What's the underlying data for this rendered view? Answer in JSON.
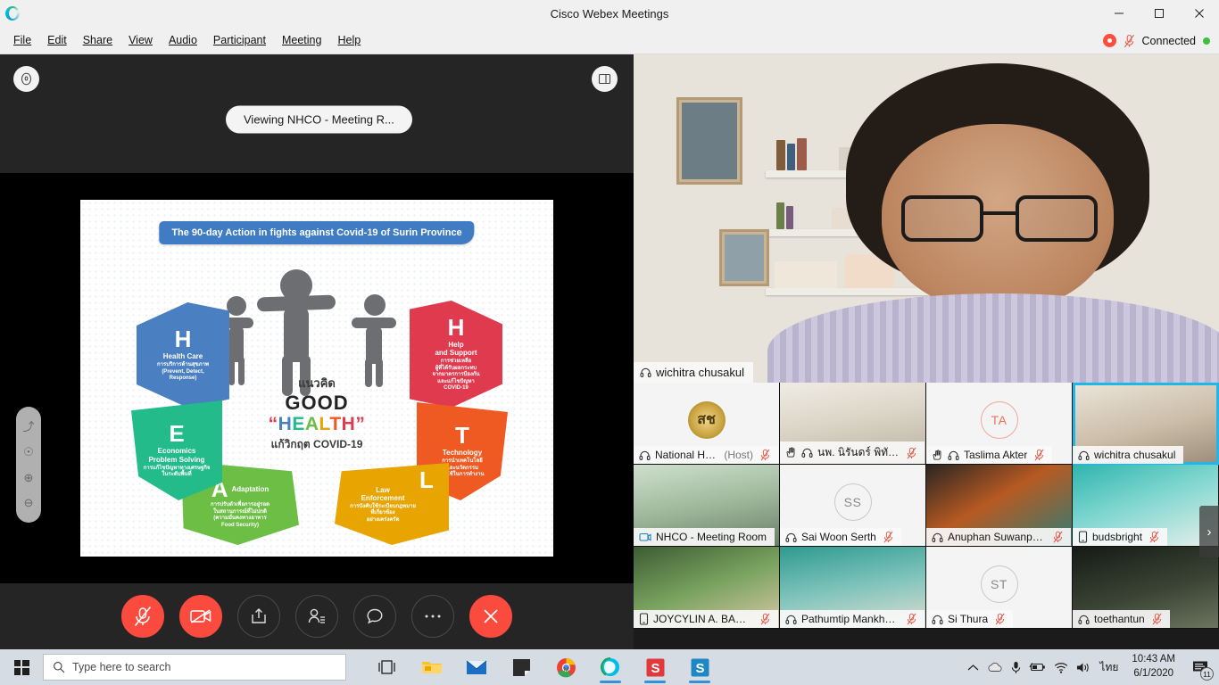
{
  "window": {
    "title": "Cisco Webex Meetings",
    "logo_icon": "webex-logo-icon",
    "minimize_label": "—",
    "maximize_label": "❐",
    "close_label": "✕"
  },
  "menu": {
    "items": [
      {
        "label": "File"
      },
      {
        "label": "Edit"
      },
      {
        "label": "Share"
      },
      {
        "label": "View"
      },
      {
        "label": "Audio"
      },
      {
        "label": "Participant"
      },
      {
        "label": "Meeting"
      },
      {
        "label": "Help"
      }
    ],
    "status": {
      "recording_icon": "recording-dot-icon",
      "mic_muted_icon": "microphone-muted-icon",
      "connection_label": "Connected",
      "connection_color": "#3fbf3f"
    }
  },
  "share": {
    "annotate_icon": "annotate-circle-icon",
    "layout_icon": "layout-panel-icon",
    "viewing_label": "Viewing NHCO - Meeting R...",
    "tools": [
      {
        "name": "pointer-tool",
        "glyph": "⤴"
      },
      {
        "name": "laser-pointer-tool",
        "glyph": "☉"
      },
      {
        "name": "zoom-in-tool",
        "glyph": "⊕"
      },
      {
        "name": "zoom-out-tool",
        "glyph": "⊖"
      }
    ]
  },
  "slide": {
    "banner": "The 90-day Action in fights against Covid-19 of Surin Province",
    "center": {
      "line1": "แนวคิด",
      "good": "GOOD",
      "health_letters": [
        {
          "ch": "“",
          "color": "#e03a4e"
        },
        {
          "ch": "H",
          "color": "#4a7fc1"
        },
        {
          "ch": "E",
          "color": "#23bb8a"
        },
        {
          "ch": "A",
          "color": "#6cbe45"
        },
        {
          "ch": "L",
          "color": "#e8a400"
        },
        {
          "ch": "T",
          "color": "#ef5a22"
        },
        {
          "ch": "H",
          "color": "#e03a4e"
        },
        {
          "ch": "”",
          "color": "#e03a4e"
        }
      ],
      "line4": "แก้วิกฤต COVID-19"
    },
    "petals": [
      {
        "key": "health-care",
        "letter": "H",
        "english": "Health Care",
        "thai": "การบริการด้านสุขภาพ\n(Prevent, Detect,\nResponse)",
        "color": "#4a7fc1"
      },
      {
        "key": "help-and-support",
        "letter": "H",
        "english": "Help\nand Support",
        "thai": "การช่วยเหลือ\nผู้ที่ได้รับผลกระทบ\nจากมาตรการป้องกัน\nและแก้ไขปัญหา\nCOVID-19",
        "color": "#e03a4e"
      },
      {
        "key": "technology",
        "letter": "T",
        "english": "Technology",
        "thai": "การนำเทคโนโลยี\nและนวัตกรรม\nมาใช้ในการทำงาน",
        "color": "#ef5a22"
      },
      {
        "key": "law-enforcement",
        "letter": "L",
        "english": "Law\nEnforcement",
        "thai": "การบังคับใช้ระเบียบกฎหมาย\nที่เกี่ยวข้อง\nอย่างเคร่งครัด",
        "color": "#e8a400"
      },
      {
        "key": "adaptation",
        "letter": "A",
        "english": "Adaptation",
        "thai": "การปรับตัวเพื่อการอยู่รอด\nในสถานการณ์ที่ไม่ปกติ\n(ความมั่นคงทางอาหาร\nFood Security)",
        "color": "#6cbe45"
      },
      {
        "key": "economics-problem-solving",
        "letter": "E",
        "english": "Economics\nProblem Solving",
        "thai": "การแก้ไขปัญหาทางเศรษฐกิจ\nในระดับพื้นที่",
        "color": "#23bb8a"
      }
    ]
  },
  "controls": [
    {
      "name": "mute-button",
      "icon": "microphone-muted-icon",
      "style": "red"
    },
    {
      "name": "stop-video-button",
      "icon": "camera-off-icon",
      "style": "red"
    },
    {
      "name": "share-screen-button",
      "icon": "share-upload-icon",
      "style": "plain"
    },
    {
      "name": "participants-button",
      "icon": "participants-icon",
      "style": "plain"
    },
    {
      "name": "chat-button",
      "icon": "chat-bubble-icon",
      "style": "plain"
    },
    {
      "name": "more-options-button",
      "icon": "ellipsis-icon",
      "style": "plain"
    },
    {
      "name": "leave-meeting-button",
      "icon": "close-x-icon",
      "style": "red"
    }
  ],
  "video": {
    "active_speaker": {
      "name": "wichitra chusakul",
      "audio_icon": "headset-icon"
    },
    "scroll_next_label": "›",
    "participants": [
      {
        "name": "National Heal...",
        "suffix": "(Host)",
        "icons": [
          "headset-icon"
        ],
        "muted": true,
        "tile": "logo",
        "logo_text": "สช",
        "active": false
      },
      {
        "name": "นพ. นิรันดร์ พิทักษ์วั...",
        "suffix": "",
        "icons": [
          "hand-raised-icon",
          "headset-icon"
        ],
        "muted": true,
        "tile": "video-office",
        "active": false
      },
      {
        "name": "Taslima Akter",
        "suffix": "",
        "icons": [
          "hand-raised-icon",
          "headset-icon"
        ],
        "muted": true,
        "tile": "initials",
        "initials": "TA",
        "active": false
      },
      {
        "name": "wichitra chusakul",
        "suffix": "",
        "icons": [
          "headset-icon"
        ],
        "muted": false,
        "tile": "video-speaker",
        "active": true
      },
      {
        "name": "NHCO - Meeting Room",
        "suffix": "",
        "icons": [
          "device-video-icon"
        ],
        "muted": false,
        "tile": "video-presenter",
        "active": false
      },
      {
        "name": "Sai Woon Serth",
        "suffix": "",
        "icons": [
          "headset-icon"
        ],
        "muted": true,
        "tile": "initials",
        "initials": "SS",
        "active": false
      },
      {
        "name": "Anuphan Suwanphan",
        "suffix": "",
        "icons": [
          "headset-icon"
        ],
        "muted": true,
        "tile": "video-desk",
        "active": false
      },
      {
        "name": "budsbright",
        "suffix": "",
        "icons": [
          "phone-icon"
        ],
        "muted": true,
        "tile": "video-stairs",
        "active": false
      },
      {
        "name": "JOYCYLIN A. BASTIAN",
        "suffix": "",
        "icons": [
          "phone-icon"
        ],
        "muted": true,
        "tile": "video-green",
        "active": false
      },
      {
        "name": "Pathumtip Mankho...",
        "suffix": "",
        "icons": [
          "headset-icon"
        ],
        "muted": true,
        "tile": "video-teal",
        "active": false
      },
      {
        "name": "Si Thura",
        "suffix": "",
        "icons": [
          "headset-icon"
        ],
        "muted": true,
        "tile": "initials",
        "initials": "ST",
        "active": false
      },
      {
        "name": "toethantun",
        "suffix": "",
        "icons": [
          "headset-icon"
        ],
        "muted": true,
        "tile": "video-dark",
        "active": false
      }
    ]
  },
  "taskbar": {
    "start_icon": "windows-start-icon",
    "search": {
      "placeholder": "Type here to search",
      "icon": "search-icon"
    },
    "apps": [
      {
        "name": "task-view-icon",
        "glyph": "⧉"
      },
      {
        "name": "file-explorer-icon"
      },
      {
        "name": "mail-icon"
      },
      {
        "name": "sticky-notes-icon"
      },
      {
        "name": "chrome-icon"
      },
      {
        "name": "webex-icon"
      },
      {
        "name": "snagit-editor-icon"
      },
      {
        "name": "snagit-capture-icon"
      }
    ],
    "tray": {
      "overflow_icon": "chevron-up-icon",
      "cloud_icon": "onedrive-icon",
      "mic_icon": "microphone-icon",
      "battery_icon": "battery-icon",
      "wifi_icon": "wifi-icon",
      "volume_icon": "speaker-icon",
      "language": "ไทย",
      "time": "10:43 AM",
      "date": "6/1/2020",
      "notification_count": "11"
    }
  }
}
